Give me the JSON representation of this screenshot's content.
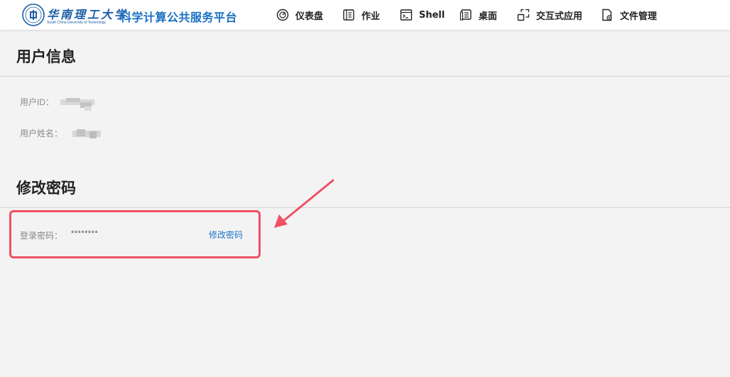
{
  "header": {
    "university_name_cn": "华南理工大学",
    "university_name_en": "South China University of Technology",
    "platform_title": "科学计算公共服务平台",
    "nav": [
      {
        "label": "仪表盘",
        "icon": "dashboard-gauge-icon"
      },
      {
        "label": "作业",
        "icon": "job-list-icon"
      },
      {
        "label": "Shell",
        "icon": "terminal-icon"
      },
      {
        "label": "桌面",
        "icon": "desktop-icon"
      },
      {
        "label": "交互式应用",
        "icon": "interactive-apps-icon"
      },
      {
        "label": "文件管理",
        "icon": "file-manager-icon"
      }
    ]
  },
  "user_info": {
    "title": "用户信息",
    "user_id_label": "用户ID：",
    "user_name_label": "用户姓名："
  },
  "change_password": {
    "title": "修改密码",
    "password_label": "登录密码：",
    "password_value": "********",
    "change_link": "修改密码"
  },
  "colors": {
    "brand": "#1b6fc2",
    "link": "#1e72c9",
    "highlight": "#ee5162",
    "background": "#f3f3f3"
  }
}
